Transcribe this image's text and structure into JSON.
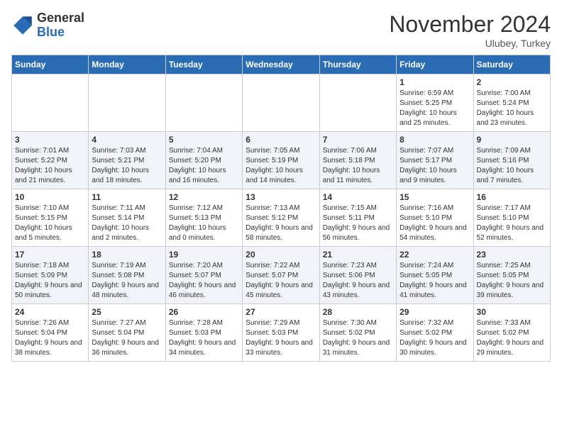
{
  "header": {
    "logo_line1": "General",
    "logo_line2": "Blue",
    "month": "November 2024",
    "location": "Ulubey, Turkey"
  },
  "weekdays": [
    "Sunday",
    "Monday",
    "Tuesday",
    "Wednesday",
    "Thursday",
    "Friday",
    "Saturday"
  ],
  "weeks": [
    [
      {
        "day": "",
        "info": ""
      },
      {
        "day": "",
        "info": ""
      },
      {
        "day": "",
        "info": ""
      },
      {
        "day": "",
        "info": ""
      },
      {
        "day": "",
        "info": ""
      },
      {
        "day": "1",
        "info": "Sunrise: 6:59 AM\nSunset: 5:25 PM\nDaylight: 10 hours and 25 minutes."
      },
      {
        "day": "2",
        "info": "Sunrise: 7:00 AM\nSunset: 5:24 PM\nDaylight: 10 hours and 23 minutes."
      }
    ],
    [
      {
        "day": "3",
        "info": "Sunrise: 7:01 AM\nSunset: 5:22 PM\nDaylight: 10 hours and 21 minutes."
      },
      {
        "day": "4",
        "info": "Sunrise: 7:03 AM\nSunset: 5:21 PM\nDaylight: 10 hours and 18 minutes."
      },
      {
        "day": "5",
        "info": "Sunrise: 7:04 AM\nSunset: 5:20 PM\nDaylight: 10 hours and 16 minutes."
      },
      {
        "day": "6",
        "info": "Sunrise: 7:05 AM\nSunset: 5:19 PM\nDaylight: 10 hours and 14 minutes."
      },
      {
        "day": "7",
        "info": "Sunrise: 7:06 AM\nSunset: 5:18 PM\nDaylight: 10 hours and 11 minutes."
      },
      {
        "day": "8",
        "info": "Sunrise: 7:07 AM\nSunset: 5:17 PM\nDaylight: 10 hours and 9 minutes."
      },
      {
        "day": "9",
        "info": "Sunrise: 7:09 AM\nSunset: 5:16 PM\nDaylight: 10 hours and 7 minutes."
      }
    ],
    [
      {
        "day": "10",
        "info": "Sunrise: 7:10 AM\nSunset: 5:15 PM\nDaylight: 10 hours and 5 minutes."
      },
      {
        "day": "11",
        "info": "Sunrise: 7:11 AM\nSunset: 5:14 PM\nDaylight: 10 hours and 2 minutes."
      },
      {
        "day": "12",
        "info": "Sunrise: 7:12 AM\nSunset: 5:13 PM\nDaylight: 10 hours and 0 minutes."
      },
      {
        "day": "13",
        "info": "Sunrise: 7:13 AM\nSunset: 5:12 PM\nDaylight: 9 hours and 58 minutes."
      },
      {
        "day": "14",
        "info": "Sunrise: 7:15 AM\nSunset: 5:11 PM\nDaylight: 9 hours and 56 minutes."
      },
      {
        "day": "15",
        "info": "Sunrise: 7:16 AM\nSunset: 5:10 PM\nDaylight: 9 hours and 54 minutes."
      },
      {
        "day": "16",
        "info": "Sunrise: 7:17 AM\nSunset: 5:10 PM\nDaylight: 9 hours and 52 minutes."
      }
    ],
    [
      {
        "day": "17",
        "info": "Sunrise: 7:18 AM\nSunset: 5:09 PM\nDaylight: 9 hours and 50 minutes."
      },
      {
        "day": "18",
        "info": "Sunrise: 7:19 AM\nSunset: 5:08 PM\nDaylight: 9 hours and 48 minutes."
      },
      {
        "day": "19",
        "info": "Sunrise: 7:20 AM\nSunset: 5:07 PM\nDaylight: 9 hours and 46 minutes."
      },
      {
        "day": "20",
        "info": "Sunrise: 7:22 AM\nSunset: 5:07 PM\nDaylight: 9 hours and 45 minutes."
      },
      {
        "day": "21",
        "info": "Sunrise: 7:23 AM\nSunset: 5:06 PM\nDaylight: 9 hours and 43 minutes."
      },
      {
        "day": "22",
        "info": "Sunrise: 7:24 AM\nSunset: 5:05 PM\nDaylight: 9 hours and 41 minutes."
      },
      {
        "day": "23",
        "info": "Sunrise: 7:25 AM\nSunset: 5:05 PM\nDaylight: 9 hours and 39 minutes."
      }
    ],
    [
      {
        "day": "24",
        "info": "Sunrise: 7:26 AM\nSunset: 5:04 PM\nDaylight: 9 hours and 38 minutes."
      },
      {
        "day": "25",
        "info": "Sunrise: 7:27 AM\nSunset: 5:04 PM\nDaylight: 9 hours and 36 minutes."
      },
      {
        "day": "26",
        "info": "Sunrise: 7:28 AM\nSunset: 5:03 PM\nDaylight: 9 hours and 34 minutes."
      },
      {
        "day": "27",
        "info": "Sunrise: 7:29 AM\nSunset: 5:03 PM\nDaylight: 9 hours and 33 minutes."
      },
      {
        "day": "28",
        "info": "Sunrise: 7:30 AM\nSunset: 5:02 PM\nDaylight: 9 hours and 31 minutes."
      },
      {
        "day": "29",
        "info": "Sunrise: 7:32 AM\nSunset: 5:02 PM\nDaylight: 9 hours and 30 minutes."
      },
      {
        "day": "30",
        "info": "Sunrise: 7:33 AM\nSunset: 5:02 PM\nDaylight: 9 hours and 29 minutes."
      }
    ]
  ]
}
